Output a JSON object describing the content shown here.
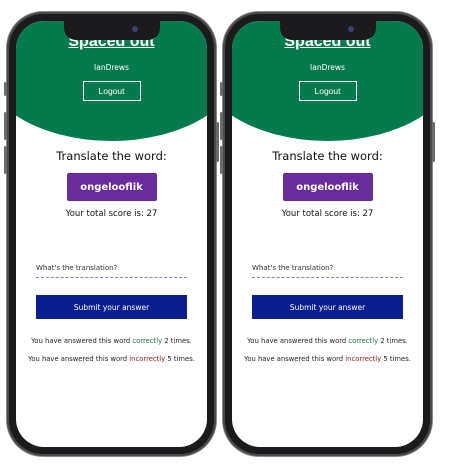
{
  "app": {
    "title": "Spaced out",
    "username": "IanDrews",
    "logout_label": "Logout"
  },
  "quiz": {
    "prompt": "Translate the word:",
    "word": "ongelooflik",
    "score_text": "Your total score is: 27",
    "translation_placeholder": "What's the translation?",
    "submit_label": "Submit your answer",
    "stats": {
      "correct_prefix": "You have answered this word",
      "correct_word": "correctly",
      "correct_suffix": "2 times.",
      "incorrect_prefix": "You have answered this word",
      "incorrect_word": "incorrectly",
      "incorrect_suffix": "5 times."
    }
  },
  "colors": {
    "header_green": "#047a4d",
    "word_purple": "#6a2b9c",
    "submit_blue": "#0a1f8f",
    "correct_green": "#1b6e3a",
    "incorrect_red": "#9a1b1b"
  }
}
